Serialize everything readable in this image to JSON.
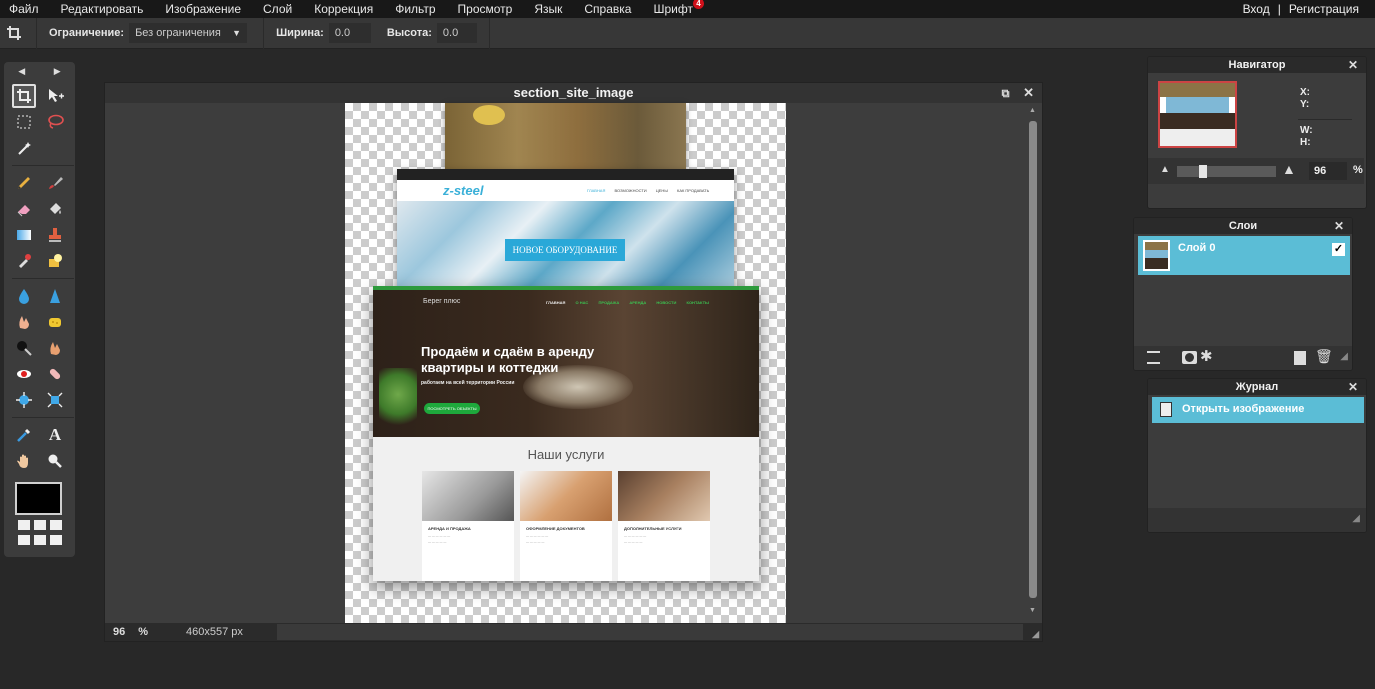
{
  "menubar": {
    "items": [
      "Файл",
      "Редактировать",
      "Изображение",
      "Слой",
      "Коррекция",
      "Фильтр",
      "Просмотр",
      "Язык",
      "Справка",
      "Шрифт"
    ],
    "font_badge": "4",
    "login": "Вход",
    "separator": "|",
    "register": "Регистрация"
  },
  "options": {
    "constraint_label": "Ограничение:",
    "constraint_value": "Без ограничения",
    "width_label": "Ширина:",
    "width_value": "0.0",
    "height_label": "Высота:",
    "height_value": "0.0"
  },
  "document": {
    "title": "section_site_image",
    "zoom": "96",
    "zoom_unit": "%",
    "size": "460x557 px"
  },
  "canvas_content": {
    "shot2_nav": [
      "ГЛАВНАЯ",
      "ВОЗМОЖНОСТИ",
      "ЦЕНЫ",
      "КАК ПРОДАВАТЬ"
    ],
    "shot2_logo": "z-steel",
    "shot2_button": "НОВОЕ ОБОРУДОВАНИЕ",
    "shot3_logo": "Берег плюс",
    "shot3_nav": [
      "ГЛАВНАЯ",
      "О НАС",
      "ПРОДАЖА",
      "АРЕНДА",
      "НОВОСТИ",
      "КОНТАКТЫ"
    ],
    "shot3_headline": "Продаём и сдаём в аренду квартиры и коттеджи",
    "shot3_sub": "работаем на всей территории России",
    "shot3_button": "ПОСМОТРЕТЬ ОБЪЕКТЫ",
    "shot3_section": "Наши услуги",
    "cards": [
      {
        "title": "АРЕНДА И ПРОДАЖА",
        "color": "#bdbdbd"
      },
      {
        "title": "ОФОРМЛЕНИЕ ДОКУМЕНТОВ",
        "color": "#c98a5c"
      },
      {
        "title": "ДОПОЛНИТЕЛЬНЫЕ УСЛУГИ",
        "color": "#8a6a4a"
      }
    ]
  },
  "navigator": {
    "title": "Навигатор",
    "x_label": "X:",
    "y_label": "Y:",
    "w_label": "W:",
    "h_label": "H:",
    "zoom": "96",
    "zoom_unit": "%"
  },
  "layers": {
    "title": "Слои",
    "items": [
      {
        "name": "Слой 0",
        "visible": true
      }
    ]
  },
  "history": {
    "title": "Журнал",
    "items": [
      "Открыть изображение"
    ]
  },
  "colors": {
    "accent": "#5bbdd6",
    "primary_color": "#000000"
  }
}
